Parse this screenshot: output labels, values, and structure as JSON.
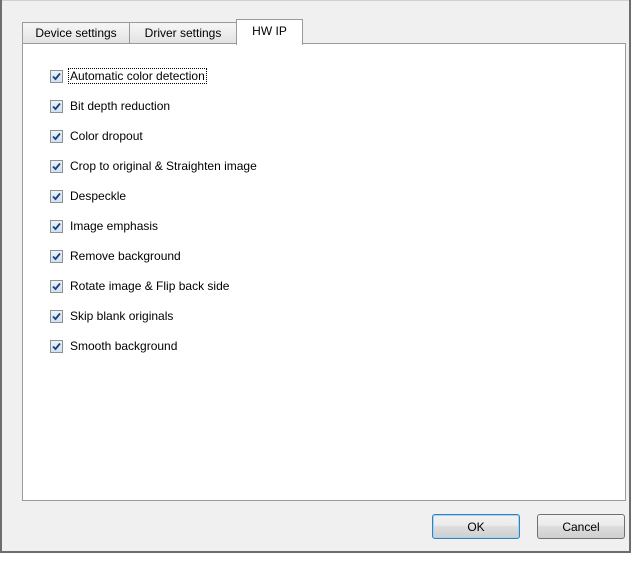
{
  "tabs": [
    {
      "label": "Device settings",
      "active": false
    },
    {
      "label": "Driver settings",
      "active": false
    },
    {
      "label": "HW IP",
      "active": true
    }
  ],
  "options": [
    {
      "label": "Automatic color detection",
      "checked": true,
      "focused": true
    },
    {
      "label": "Bit depth reduction",
      "checked": true
    },
    {
      "label": "Color dropout",
      "checked": true
    },
    {
      "label": "Crop to original & Straighten image",
      "checked": true
    },
    {
      "label": "Despeckle",
      "checked": true
    },
    {
      "label": "Image emphasis",
      "checked": true
    },
    {
      "label": "Remove background",
      "checked": true
    },
    {
      "label": "Rotate image & Flip back side",
      "checked": true
    },
    {
      "label": "Skip blank originals",
      "checked": true
    },
    {
      "label": "Smooth background",
      "checked": true
    }
  ],
  "buttons": {
    "ok_label": "OK",
    "cancel_label": "Cancel"
  },
  "icons": {
    "checkmark": "checkmark-icon"
  },
  "colors": {
    "check_color": "#1e3f7a",
    "default_button_border": "#3c7fb1"
  }
}
